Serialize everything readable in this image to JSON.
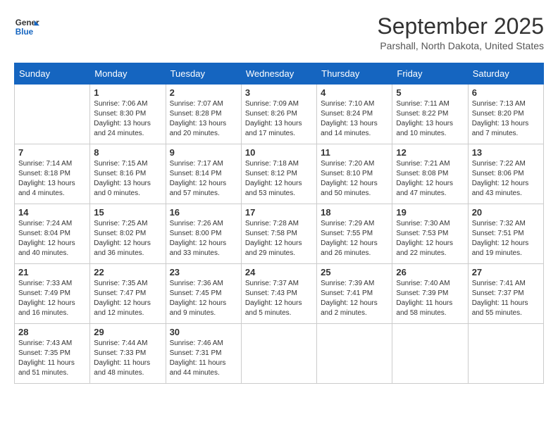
{
  "header": {
    "logo_line1": "General",
    "logo_line2": "Blue",
    "title": "September 2025",
    "subtitle": "Parshall, North Dakota, United States"
  },
  "weekdays": [
    "Sunday",
    "Monday",
    "Tuesday",
    "Wednesday",
    "Thursday",
    "Friday",
    "Saturday"
  ],
  "weeks": [
    [
      {
        "day": "",
        "info": ""
      },
      {
        "day": "1",
        "info": "Sunrise: 7:06 AM\nSunset: 8:30 PM\nDaylight: 13 hours\nand 24 minutes."
      },
      {
        "day": "2",
        "info": "Sunrise: 7:07 AM\nSunset: 8:28 PM\nDaylight: 13 hours\nand 20 minutes."
      },
      {
        "day": "3",
        "info": "Sunrise: 7:09 AM\nSunset: 8:26 PM\nDaylight: 13 hours\nand 17 minutes."
      },
      {
        "day": "4",
        "info": "Sunrise: 7:10 AM\nSunset: 8:24 PM\nDaylight: 13 hours\nand 14 minutes."
      },
      {
        "day": "5",
        "info": "Sunrise: 7:11 AM\nSunset: 8:22 PM\nDaylight: 13 hours\nand 10 minutes."
      },
      {
        "day": "6",
        "info": "Sunrise: 7:13 AM\nSunset: 8:20 PM\nDaylight: 13 hours\nand 7 minutes."
      }
    ],
    [
      {
        "day": "7",
        "info": "Sunrise: 7:14 AM\nSunset: 8:18 PM\nDaylight: 13 hours\nand 4 minutes."
      },
      {
        "day": "8",
        "info": "Sunrise: 7:15 AM\nSunset: 8:16 PM\nDaylight: 13 hours\nand 0 minutes."
      },
      {
        "day": "9",
        "info": "Sunrise: 7:17 AM\nSunset: 8:14 PM\nDaylight: 12 hours\nand 57 minutes."
      },
      {
        "day": "10",
        "info": "Sunrise: 7:18 AM\nSunset: 8:12 PM\nDaylight: 12 hours\nand 53 minutes."
      },
      {
        "day": "11",
        "info": "Sunrise: 7:20 AM\nSunset: 8:10 PM\nDaylight: 12 hours\nand 50 minutes."
      },
      {
        "day": "12",
        "info": "Sunrise: 7:21 AM\nSunset: 8:08 PM\nDaylight: 12 hours\nand 47 minutes."
      },
      {
        "day": "13",
        "info": "Sunrise: 7:22 AM\nSunset: 8:06 PM\nDaylight: 12 hours\nand 43 minutes."
      }
    ],
    [
      {
        "day": "14",
        "info": "Sunrise: 7:24 AM\nSunset: 8:04 PM\nDaylight: 12 hours\nand 40 minutes."
      },
      {
        "day": "15",
        "info": "Sunrise: 7:25 AM\nSunset: 8:02 PM\nDaylight: 12 hours\nand 36 minutes."
      },
      {
        "day": "16",
        "info": "Sunrise: 7:26 AM\nSunset: 8:00 PM\nDaylight: 12 hours\nand 33 minutes."
      },
      {
        "day": "17",
        "info": "Sunrise: 7:28 AM\nSunset: 7:58 PM\nDaylight: 12 hours\nand 29 minutes."
      },
      {
        "day": "18",
        "info": "Sunrise: 7:29 AM\nSunset: 7:55 PM\nDaylight: 12 hours\nand 26 minutes."
      },
      {
        "day": "19",
        "info": "Sunrise: 7:30 AM\nSunset: 7:53 PM\nDaylight: 12 hours\nand 22 minutes."
      },
      {
        "day": "20",
        "info": "Sunrise: 7:32 AM\nSunset: 7:51 PM\nDaylight: 12 hours\nand 19 minutes."
      }
    ],
    [
      {
        "day": "21",
        "info": "Sunrise: 7:33 AM\nSunset: 7:49 PM\nDaylight: 12 hours\nand 16 minutes."
      },
      {
        "day": "22",
        "info": "Sunrise: 7:35 AM\nSunset: 7:47 PM\nDaylight: 12 hours\nand 12 minutes."
      },
      {
        "day": "23",
        "info": "Sunrise: 7:36 AM\nSunset: 7:45 PM\nDaylight: 12 hours\nand 9 minutes."
      },
      {
        "day": "24",
        "info": "Sunrise: 7:37 AM\nSunset: 7:43 PM\nDaylight: 12 hours\nand 5 minutes."
      },
      {
        "day": "25",
        "info": "Sunrise: 7:39 AM\nSunset: 7:41 PM\nDaylight: 12 hours\nand 2 minutes."
      },
      {
        "day": "26",
        "info": "Sunrise: 7:40 AM\nSunset: 7:39 PM\nDaylight: 11 hours\nand 58 minutes."
      },
      {
        "day": "27",
        "info": "Sunrise: 7:41 AM\nSunset: 7:37 PM\nDaylight: 11 hours\nand 55 minutes."
      }
    ],
    [
      {
        "day": "28",
        "info": "Sunrise: 7:43 AM\nSunset: 7:35 PM\nDaylight: 11 hours\nand 51 minutes."
      },
      {
        "day": "29",
        "info": "Sunrise: 7:44 AM\nSunset: 7:33 PM\nDaylight: 11 hours\nand 48 minutes."
      },
      {
        "day": "30",
        "info": "Sunrise: 7:46 AM\nSunset: 7:31 PM\nDaylight: 11 hours\nand 44 minutes."
      },
      {
        "day": "",
        "info": ""
      },
      {
        "day": "",
        "info": ""
      },
      {
        "day": "",
        "info": ""
      },
      {
        "day": "",
        "info": ""
      }
    ]
  ]
}
